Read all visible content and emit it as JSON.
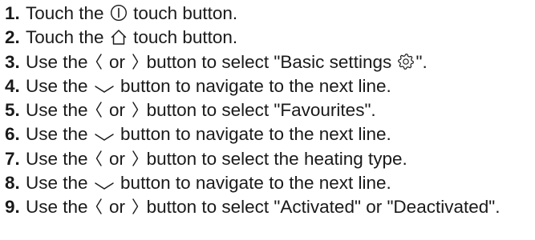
{
  "steps": [
    {
      "number": "1",
      "parts": [
        {
          "text": "Touch the "
        },
        {
          "icon": "power-icon"
        },
        {
          "text": " touch button."
        }
      ]
    },
    {
      "number": "2",
      "parts": [
        {
          "text": "Touch the "
        },
        {
          "icon": "home-icon"
        },
        {
          "text": " touch button."
        }
      ]
    },
    {
      "number": "3",
      "parts": [
        {
          "text": "Use the "
        },
        {
          "icon": "chevron-left-icon"
        },
        {
          "text": " or "
        },
        {
          "icon": "chevron-right-icon"
        },
        {
          "text": " button to select \"Basic settings "
        },
        {
          "icon": "gear-icon"
        },
        {
          "text": "\"."
        }
      ]
    },
    {
      "number": "4",
      "parts": [
        {
          "text": "Use the "
        },
        {
          "icon": "chevron-down-icon"
        },
        {
          "text": " button to navigate to the next line."
        }
      ]
    },
    {
      "number": "5",
      "parts": [
        {
          "text": "Use the "
        },
        {
          "icon": "chevron-left-icon"
        },
        {
          "text": " or "
        },
        {
          "icon": "chevron-right-icon"
        },
        {
          "text": " button to select \"Favourites\"."
        }
      ]
    },
    {
      "number": "6",
      "parts": [
        {
          "text": "Use the "
        },
        {
          "icon": "chevron-down-icon"
        },
        {
          "text": " button to navigate to the next line."
        }
      ]
    },
    {
      "number": "7",
      "parts": [
        {
          "text": "Use the "
        },
        {
          "icon": "chevron-left-icon"
        },
        {
          "text": " or "
        },
        {
          "icon": "chevron-right-icon"
        },
        {
          "text": " button to select the heating type."
        }
      ]
    },
    {
      "number": "8",
      "parts": [
        {
          "text": "Use the "
        },
        {
          "icon": "chevron-down-icon"
        },
        {
          "text": " button to navigate to the next line."
        }
      ]
    },
    {
      "number": "9",
      "parts": [
        {
          "text": "Use the "
        },
        {
          "icon": "chevron-left-icon"
        },
        {
          "text": " or "
        },
        {
          "icon": "chevron-right-icon"
        },
        {
          "text": " button to select \"Activated\" or \"Deactivated\"."
        }
      ]
    }
  ]
}
